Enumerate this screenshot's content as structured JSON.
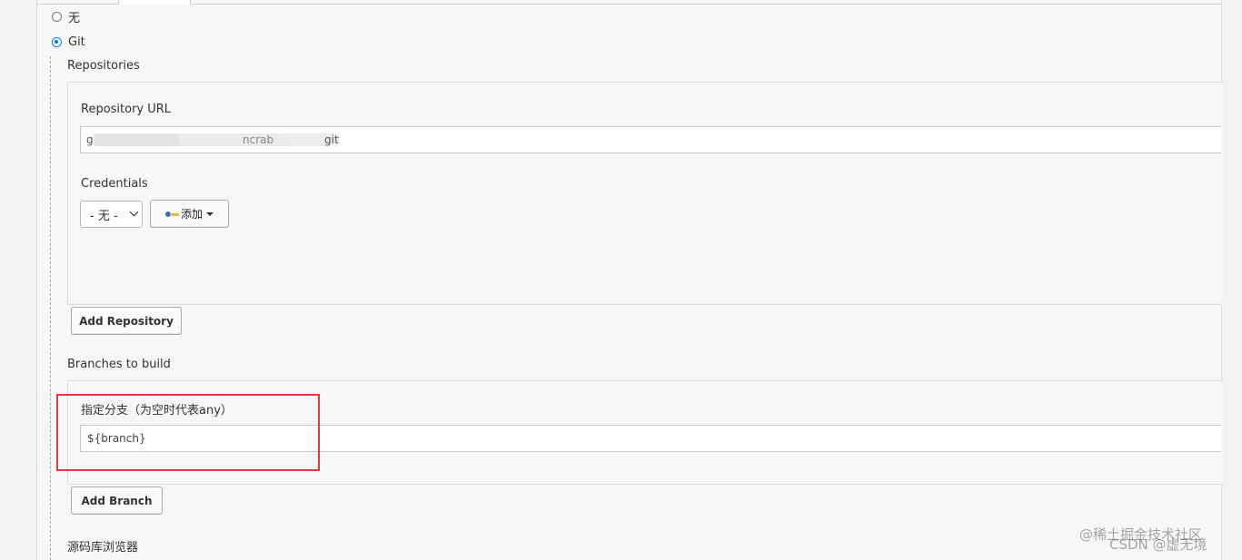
{
  "scm": {
    "option_none": "无",
    "option_git": "Git"
  },
  "repositories": {
    "heading": "Repositories",
    "url_label": "Repository URL",
    "url_value_fragment_1": "g",
    "url_value_fragment_2": "ncrab",
    "url_value_fragment_3": "git",
    "credentials_label": "Credentials",
    "credentials_selected": "- 无 -",
    "add_credentials_label": "添加",
    "add_repository_label": "Add Repository"
  },
  "branches": {
    "heading": "Branches to build",
    "specifier_label": "指定分支（为空时代表any）",
    "specifier_value": "${branch}",
    "add_branch_label": "Add Branch"
  },
  "repository_browser": {
    "heading": "源码库浏览器"
  },
  "watermark": {
    "line1": "@稀土掘金技术社区",
    "line2": "CSDN @虚无境"
  },
  "colors": {
    "highlight": "#e0393e",
    "radio_selected": "#0075ff"
  }
}
